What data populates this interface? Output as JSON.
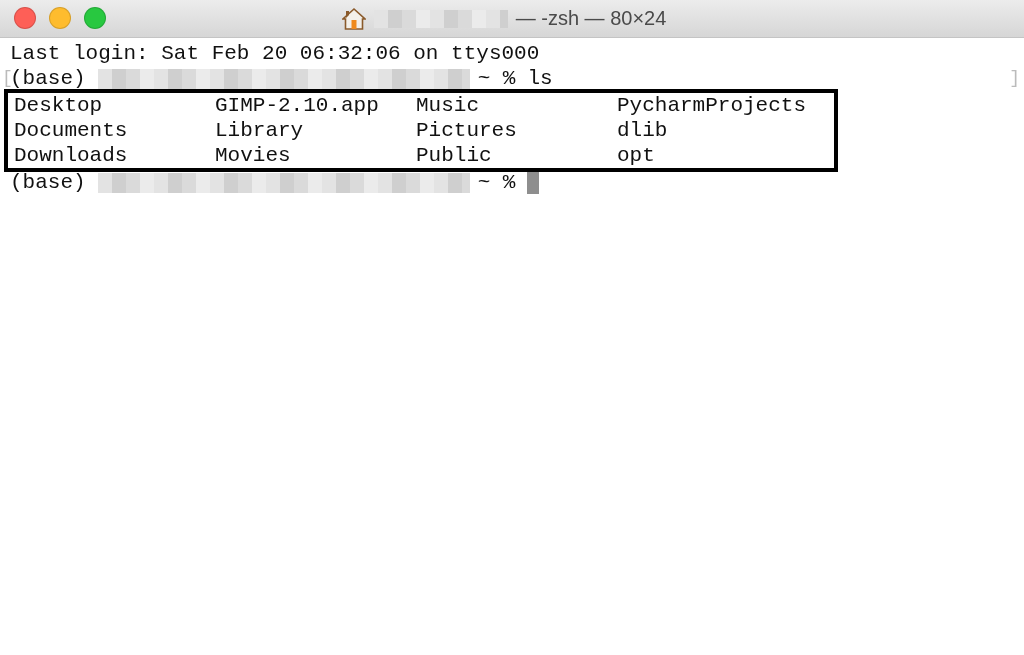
{
  "window": {
    "title": "— -zsh — 80×24",
    "buttons": [
      {
        "color": "#fe5f57"
      },
      {
        "color": "#febc2e"
      },
      {
        "color": "#28c840"
      }
    ]
  },
  "terminal": {
    "login": "Last login: Sat Feb 20 06:32:06 on ttys000",
    "prompts": [
      {
        "env": "(base)",
        "symbol": "~ %",
        "command": "ls",
        "bracket_left": "[",
        "bracket_right": "]",
        "cursor": false
      },
      {
        "env": "(base)",
        "symbol": "~ %",
        "cursor": true
      }
    ],
    "listing": {
      "highlighted": true,
      "rows": [
        [
          "Desktop",
          "GIMP-2.10.app",
          "Music",
          "PycharmProjects"
        ],
        [
          "Documents",
          "Library",
          "Pictures",
          "dlib"
        ],
        [
          "Downloads",
          "Movies",
          "Public",
          "opt"
        ]
      ]
    }
  }
}
